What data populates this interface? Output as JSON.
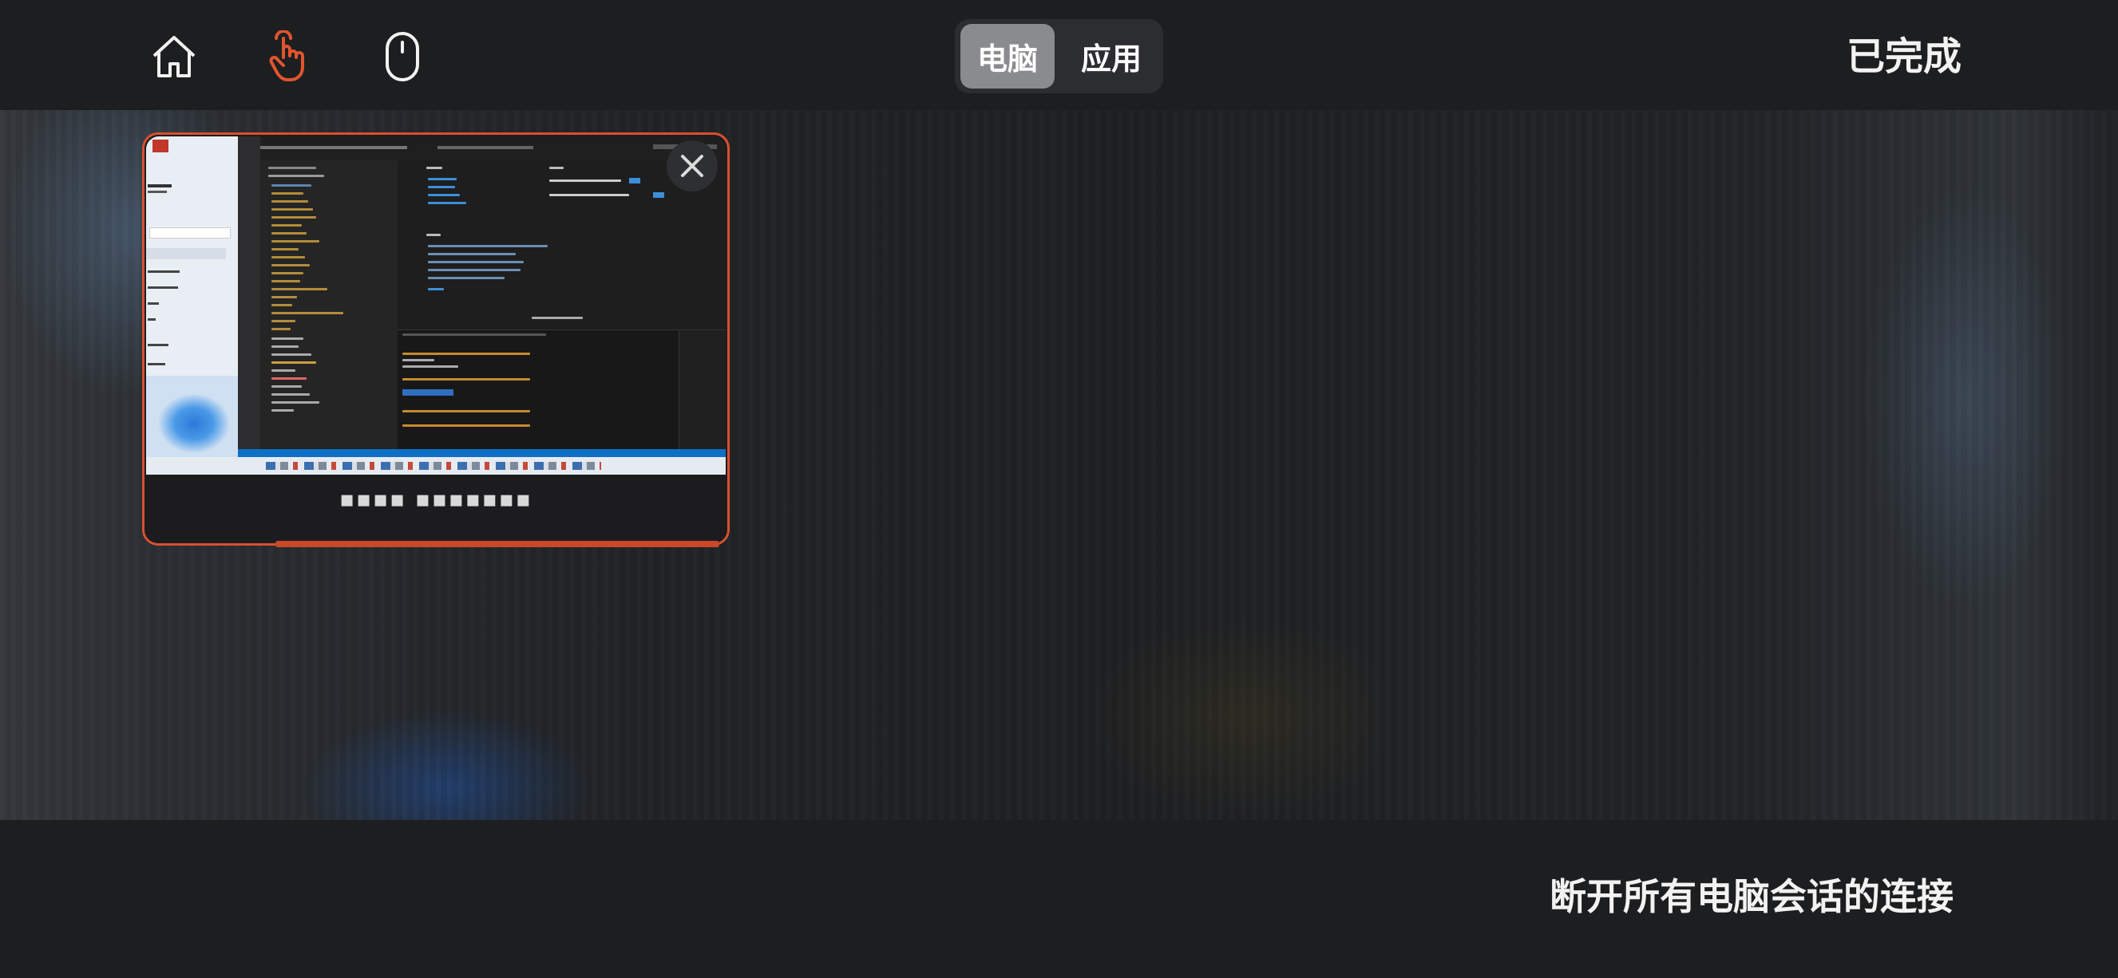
{
  "toolbar": {
    "home_icon": "home-icon",
    "touch_icon": "touch-hand-icon",
    "mouse_icon": "mouse-icon",
    "segments": [
      "电脑",
      "应用"
    ],
    "active_segment": "电脑",
    "done_label": "已完成"
  },
  "session_card": {
    "caption": "▪▪▪▪ ▪▪▪▪▪▪▪",
    "thumbnail_title": "Visual Studio Code",
    "close_icon": "close-icon"
  },
  "footer": {
    "disconnect_label": "断开所有电脑会话的连接"
  },
  "colors": {
    "accent": "#d9502e",
    "background": "#202123",
    "active_segment_bg": "#8a8b8e"
  }
}
